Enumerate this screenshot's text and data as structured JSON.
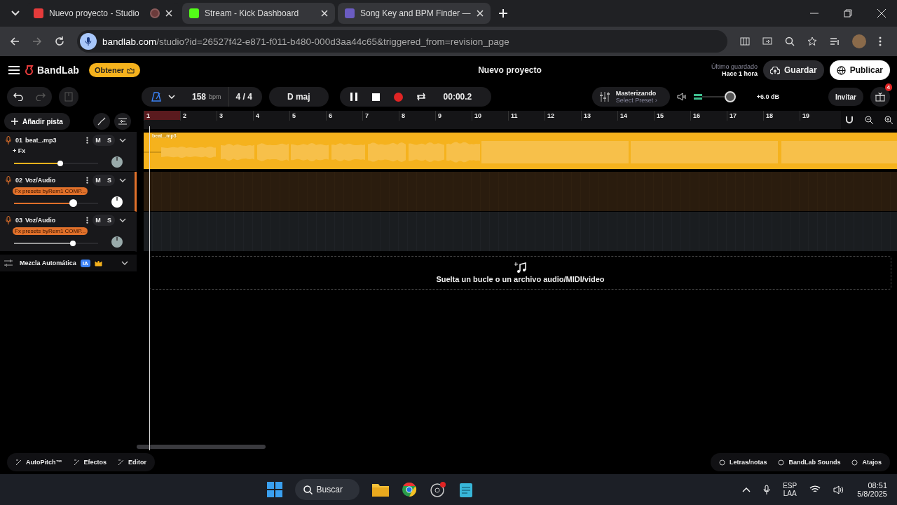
{
  "browser": {
    "tabs": [
      {
        "title": "Nuevo proyecto - Studio",
        "selected": true,
        "recording": true
      },
      {
        "title": "Stream - Kick Dashboard",
        "selected": false,
        "recording": false
      },
      {
        "title": "Song Key and BPM Finder —",
        "selected": false,
        "recording": false
      }
    ],
    "url_host": "bandlab.com",
    "url_path": "/studio?id=26527f42-e871-f011-b480-000d3aa44c65&triggered_from=revision_page"
  },
  "header": {
    "brand": "BandLab",
    "get_button": "Obtener",
    "project_title": "Nuevo proyecto",
    "saved_label": "Último guardado",
    "saved_time": "Hace 1 hora",
    "save_button": "Guardar",
    "publish_button": "Publicar"
  },
  "toolbar": {
    "tempo": "158",
    "tempo_unit": "bpm",
    "time_signature": "4 / 4",
    "key": "D maj",
    "playing": true,
    "time": "00:00.2",
    "master_title": "Masterizando",
    "master_preset": "Select Preset ›",
    "master_volume": {
      "level": 1.0
    },
    "master_reading": "+6.0 dB",
    "invite_button": "Invitar",
    "gift_badge": "4"
  },
  "add_track_button": "Añadir pista",
  "ruler": [
    "1",
    "2",
    "3",
    "4",
    "5",
    "6",
    "7",
    "8",
    "9",
    "10",
    "11",
    "12",
    "13",
    "14",
    "15",
    "16",
    "17",
    "18",
    "19"
  ],
  "tracks": [
    {
      "number": "01",
      "name": "beat_.mp3",
      "mute": "M",
      "solo": "S",
      "fx": "+ Fx",
      "kind": "plain",
      "volume": {
        "level": 0.55
      },
      "color": "#f5b21d",
      "selected": false,
      "region": "beat_.mp3"
    },
    {
      "number": "02",
      "name": "Voz/Audio",
      "mute": "M",
      "solo": "S",
      "fx": "Fx presets byRem1 COMP...",
      "kind": "preset",
      "volume": {
        "level": 0.7
      },
      "color": "#e0702a",
      "selected": true
    },
    {
      "number": "03",
      "name": "Voz/Audio",
      "mute": "M",
      "solo": "S",
      "fx": "Fx presets byRem1 COMP...",
      "kind": "preset",
      "volume": {
        "level": 0.7
      },
      "color": "#9a9a9a",
      "selected": false
    }
  ],
  "automix": {
    "label": "Mezcla Automática",
    "badge": "IA"
  },
  "drop_zone": "Suelta un bucle o un archivo audio/MIDI/video",
  "bottom_bar": {
    "left": [
      "AutoPitch™",
      "Efectos",
      "Editor"
    ],
    "right": [
      "Letras/notas",
      "BandLab Sounds",
      "Atajos"
    ]
  },
  "taskbar": {
    "search": "Buscar",
    "language": "ESP",
    "layout": "LAA",
    "time": "08:51",
    "date": "5/8/2025"
  }
}
